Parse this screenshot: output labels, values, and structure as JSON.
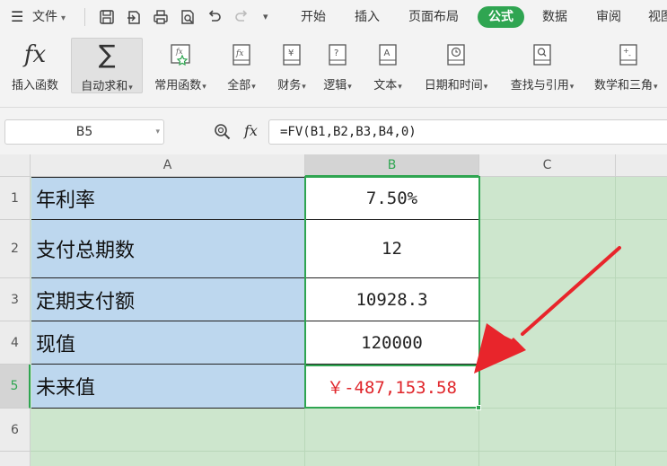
{
  "menubar": {
    "file_menu": "文件",
    "tabs": [
      "开始",
      "插入",
      "页面布局",
      "公式",
      "数据",
      "审阅",
      "视图"
    ],
    "active_tab_index": 3
  },
  "ribbon": {
    "buttons": [
      {
        "label": "插入函数",
        "icon": "fx-icon",
        "has_dropdown": false
      },
      {
        "label": "自动求和",
        "icon": "sigma-icon",
        "has_dropdown": true,
        "selected": true
      },
      {
        "label": "常用函数",
        "icon": "star-function-icon",
        "has_dropdown": true
      },
      {
        "label": "全部",
        "icon": "function-book-icon",
        "has_dropdown": true
      },
      {
        "label": "财务",
        "icon": "yen-book-icon",
        "has_dropdown": true
      },
      {
        "label": "逻辑",
        "icon": "question-book-icon",
        "has_dropdown": true
      },
      {
        "label": "文本",
        "icon": "text-book-icon",
        "has_dropdown": true
      },
      {
        "label": "日期和时间",
        "icon": "clock-book-icon",
        "has_dropdown": true
      },
      {
        "label": "查找与引用",
        "icon": "search-book-icon",
        "has_dropdown": true
      },
      {
        "label": "数学和三角",
        "icon": "math-book-icon",
        "has_dropdown": true
      }
    ]
  },
  "formula_bar": {
    "name_box": "B5",
    "fx_label": "fx",
    "formula": "=FV(B1,B2,B3,B4,0)"
  },
  "grid": {
    "columns": [
      "A",
      "B",
      "C"
    ],
    "active_column": "B",
    "rows": [
      {
        "num": "1",
        "a": "年利率",
        "b": "7.50%"
      },
      {
        "num": "2",
        "a": "支付总期数",
        "b": "12"
      },
      {
        "num": "3",
        "a": "定期支付额",
        "b": "10928.3"
      },
      {
        "num": "4",
        "a": "现值",
        "b": "120000"
      },
      {
        "num": "5",
        "a": "未来值",
        "b": "￥-487,153.58"
      },
      {
        "num": "6",
        "a": "",
        "b": ""
      }
    ],
    "active_row": "5"
  },
  "colors": {
    "accent_green": "#2fa551",
    "label_fill": "#bdd7ee",
    "sheet_fill": "#cde6cd",
    "negative_red": "#e0262b",
    "annotation_arrow": "#e8252b"
  }
}
